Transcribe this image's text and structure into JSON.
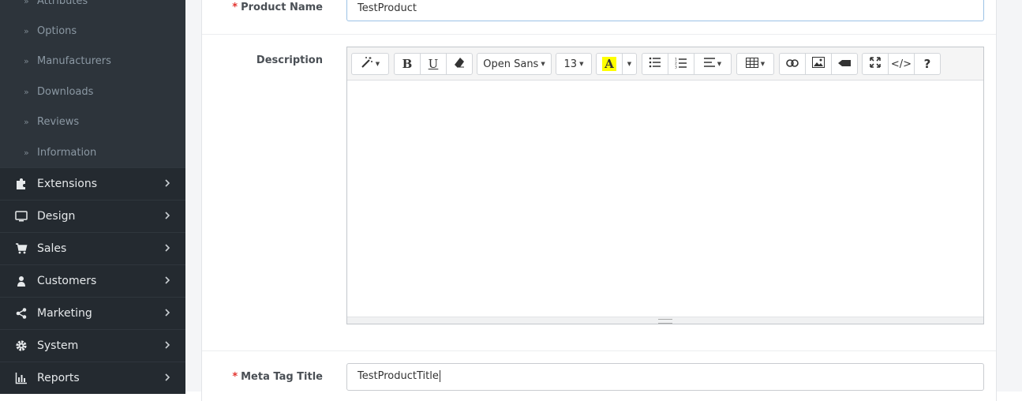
{
  "sidebar": {
    "sub_items": [
      {
        "label": "Attributes"
      },
      {
        "label": "Options"
      },
      {
        "label": "Manufacturers"
      },
      {
        "label": "Downloads"
      },
      {
        "label": "Reviews"
      },
      {
        "label": "Information"
      }
    ],
    "menu_items": [
      {
        "label": "Extensions",
        "icon": "puzzle-icon"
      },
      {
        "label": "Design",
        "icon": "monitor-icon"
      },
      {
        "label": "Sales",
        "icon": "cart-icon"
      },
      {
        "label": "Customers",
        "icon": "user-icon"
      },
      {
        "label": "Marketing",
        "icon": "share-icon"
      },
      {
        "label": "System",
        "icon": "gear-icon"
      },
      {
        "label": "Reports",
        "icon": "bar-chart-icon"
      }
    ]
  },
  "form": {
    "required_mark": "*",
    "product_name": {
      "label": "Product Name",
      "value": "TestProduct"
    },
    "description": {
      "label": "Description"
    },
    "meta_tag_title": {
      "label": "Meta Tag Title",
      "value": "TestProductTitle"
    }
  },
  "editor": {
    "font_family": "Open Sans",
    "font_size": "13",
    "bold_glyph": "B",
    "underline_glyph": "U",
    "highlight_glyph": "A",
    "highlight_color": "#ffff00",
    "code_glyph": "</>",
    "help_glyph": "?"
  },
  "colors": {
    "sidebar_bg": "#2d343b",
    "menu_bg": "#242a30",
    "required": "#e3342f",
    "focus_border": "#9cc2e6"
  }
}
